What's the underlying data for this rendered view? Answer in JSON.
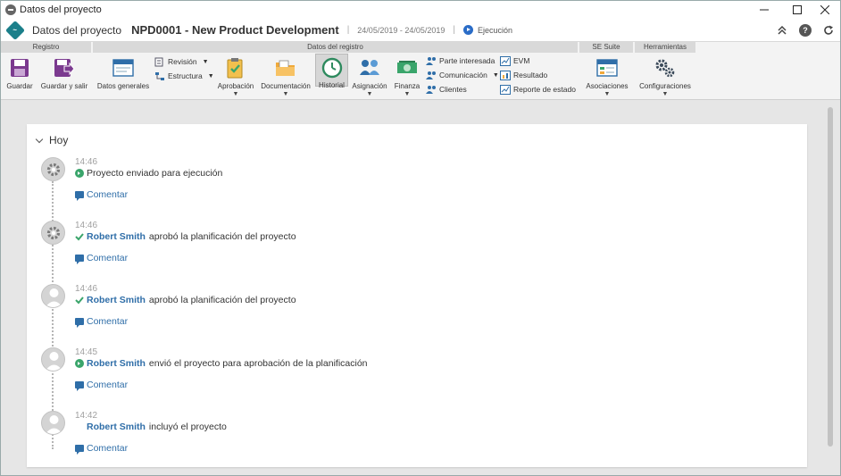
{
  "window": {
    "title": "Datos del proyecto"
  },
  "header": {
    "section": "Datos del proyecto",
    "title": "NPD0001 - New Product Development",
    "separator": "|",
    "dates": "24/05/2019 - 24/05/2019",
    "status": "Ejecución"
  },
  "ribbon": {
    "groups": {
      "registro": "Registro",
      "datos_registro": "Datos del registro",
      "se_suite": "SE Suite",
      "herramientas": "Herramientas"
    },
    "buttons": {
      "guardar": "Guardar",
      "guardar_salir": "Guardar y salir",
      "datos_generales": "Datos generales",
      "revision": "Revisión",
      "estructura": "Estructura",
      "aprobacion": "Aprobación",
      "documentacion": "Documentación",
      "historial": "Historial",
      "asignacion": "Asignación",
      "finanza": "Finanza",
      "parte_interesada": "Parte interesada",
      "comunicacion": "Comunicación",
      "clientes": "Clientes",
      "evm": "EVM",
      "resultado": "Resultado",
      "reporte_estado": "Reporte de estado",
      "asociaciones": "Asociaciones",
      "configuraciones": "Configuraciones"
    }
  },
  "timeline": {
    "day": "Hoy",
    "comment_label": "Comentar",
    "entries": [
      {
        "time": "14:46",
        "user": "",
        "text": "Proyecto enviado para ejecución",
        "avatar": "gear",
        "status_icon": "arrow-green"
      },
      {
        "time": "14:46",
        "user": "Robert Smith",
        "text": "aprobó la planificación del proyecto",
        "avatar": "gear",
        "status_icon": "check-green"
      },
      {
        "time": "14:46",
        "user": "Robert Smith",
        "text": "aprobó la planificación del proyecto",
        "avatar": "person",
        "status_icon": "check-green"
      },
      {
        "time": "14:45",
        "user": "Robert Smith",
        "text": "envió el proyecto para aprobación de la planificación",
        "avatar": "person",
        "status_icon": "arrow-green"
      },
      {
        "time": "14:42",
        "user": "Robert Smith",
        "text": "incluyó el proyecto",
        "avatar": "person",
        "status_icon": ""
      }
    ]
  },
  "colors": {
    "accent": "#2f6ea8",
    "brand": "#1b7f8a",
    "green": "#3aa56b",
    "purple": "#7b3a8f"
  }
}
